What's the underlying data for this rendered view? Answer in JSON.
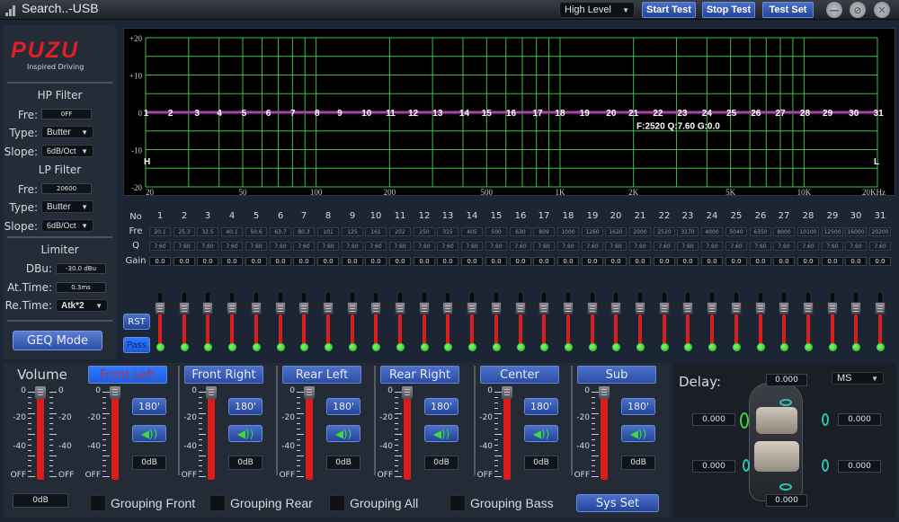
{
  "titlebar": {
    "app_title": "Search..-USB",
    "input_mode": "High Level",
    "buttons": [
      "Start Test",
      "Stop Test",
      "Test Set"
    ],
    "window_controls": [
      "minimize-icon",
      "restore-icon",
      "close-icon"
    ]
  },
  "brand": {
    "logo": "PUZU",
    "tagline": "Inspired Driving"
  },
  "hp_filter": {
    "title": "HP Filter",
    "fre_label": "Fre:",
    "fre": "0FF",
    "type_label": "Type:",
    "type": "Butter",
    "slope_label": "Slope:",
    "slope": "6dB/Oct"
  },
  "lp_filter": {
    "title": "LP Filter",
    "fre_label": "Fre:",
    "fre": "20600",
    "type_label": "Type:",
    "type": "Butter",
    "slope_label": "Slope:",
    "slope": "6dB/Oct"
  },
  "limiter": {
    "title": "Limiter",
    "dbu_label": "DBu:",
    "dbu": "-30.0 dBu",
    "at_label": "At.Time:",
    "at": "0.3ms",
    "re_label": "Re.Time:",
    "re": "Atk*2"
  },
  "geq_mode_label": "GEQ Mode",
  "graph": {
    "y_ticks": [
      "+20",
      "+10",
      "0",
      "-10",
      "-20"
    ],
    "x_ticks": [
      "20",
      "50",
      "100",
      "200",
      "500",
      "1K",
      "2K",
      "5K",
      "10K",
      "20KHz"
    ],
    "left_marker": "H",
    "right_marker": "L",
    "readout": "F:2520 Q:7.60 G:0.0",
    "curve_color": "#b03fb0",
    "grid_color": "#3fbf3f"
  },
  "eq": {
    "row_labels": {
      "no": "No",
      "fre": "Fre",
      "q": "Q",
      "gain": "Gain"
    },
    "bands": [
      {
        "no": "1",
        "fre": "20.1",
        "q": "7.60",
        "gain": "0.0"
      },
      {
        "no": "2",
        "fre": "25.3",
        "q": "7.60",
        "gain": "0.0"
      },
      {
        "no": "3",
        "fre": "32.5",
        "q": "7.60",
        "gain": "0.0"
      },
      {
        "no": "4",
        "fre": "40.1",
        "q": "7.60",
        "gain": "0.0"
      },
      {
        "no": "5",
        "fre": "50.6",
        "q": "7.60",
        "gain": "0.0"
      },
      {
        "no": "6",
        "fre": "63.7",
        "q": "7.60",
        "gain": "0.0"
      },
      {
        "no": "7",
        "fre": "80.3",
        "q": "7.60",
        "gain": "0.0"
      },
      {
        "no": "8",
        "fre": "101",
        "q": "7.60",
        "gain": "0.0"
      },
      {
        "no": "9",
        "fre": "125",
        "q": "7.60",
        "gain": "0.0"
      },
      {
        "no": "10",
        "fre": "161",
        "q": "7.60",
        "gain": "0.0"
      },
      {
        "no": "11",
        "fre": "202",
        "q": "7.60",
        "gain": "0.0"
      },
      {
        "no": "12",
        "fre": "250",
        "q": "7.60",
        "gain": "0.0"
      },
      {
        "no": "13",
        "fre": "315",
        "q": "7.60",
        "gain": "0.0"
      },
      {
        "no": "14",
        "fre": "405",
        "q": "7.60",
        "gain": "0.0"
      },
      {
        "no": "15",
        "fre": "500",
        "q": "7.60",
        "gain": "0.0"
      },
      {
        "no": "16",
        "fre": "630",
        "q": "7.60",
        "gain": "0.0"
      },
      {
        "no": "17",
        "fre": "809",
        "q": "7.60",
        "gain": "0.0"
      },
      {
        "no": "18",
        "fre": "1000",
        "q": "7.60",
        "gain": "0.0"
      },
      {
        "no": "19",
        "fre": "1260",
        "q": "7.60",
        "gain": "0.0"
      },
      {
        "no": "20",
        "fre": "1620",
        "q": "7.60",
        "gain": "0.0"
      },
      {
        "no": "21",
        "fre": "2000",
        "q": "7.60",
        "gain": "0.0"
      },
      {
        "no": "22",
        "fre": "2520",
        "q": "7.60",
        "gain": "0.0"
      },
      {
        "no": "23",
        "fre": "3170",
        "q": "7.60",
        "gain": "0.0"
      },
      {
        "no": "24",
        "fre": "4000",
        "q": "7.60",
        "gain": "0.0"
      },
      {
        "no": "25",
        "fre": "5040",
        "q": "7.60",
        "gain": "0.0"
      },
      {
        "no": "26",
        "fre": "6350",
        "q": "7.60",
        "gain": "0.0"
      },
      {
        "no": "27",
        "fre": "8000",
        "q": "7.60",
        "gain": "0.0"
      },
      {
        "no": "28",
        "fre": "10100",
        "q": "7.60",
        "gain": "0.0"
      },
      {
        "no": "29",
        "fre": "12500",
        "q": "7.60",
        "gain": "0.0"
      },
      {
        "no": "30",
        "fre": "16000",
        "q": "7.60",
        "gain": "0.0"
      },
      {
        "no": "31",
        "fre": "20200",
        "q": "7.60",
        "gain": "0.0"
      }
    ],
    "rst_label": "RST",
    "pass_label": "Pass",
    "gain_range_db": [
      -20,
      20
    ]
  },
  "volume": {
    "title": "Volume",
    "value": "0dB",
    "level_db": 0,
    "scale": [
      "0",
      "-20",
      "-40",
      "OFF"
    ]
  },
  "channels": [
    {
      "name": "Front Left",
      "active": true,
      "phase": "180'",
      "value": "0dB",
      "level_db": 0
    },
    {
      "name": "Front Right",
      "active": false,
      "phase": "180'",
      "value": "0dB",
      "level_db": 0
    },
    {
      "name": "Rear Left",
      "active": false,
      "phase": "180'",
      "value": "0dB",
      "level_db": 0
    },
    {
      "name": "Rear Right",
      "active": false,
      "phase": "180'",
      "value": "0dB",
      "level_db": 0
    },
    {
      "name": "Center",
      "active": false,
      "phase": "180'",
      "value": "0dB",
      "level_db": 0
    },
    {
      "name": "Sub",
      "active": false,
      "phase": "180'",
      "value": "0dB",
      "level_db": 0
    }
  ],
  "channel_scale": [
    "0",
    "-20",
    "-40",
    "OFF"
  ],
  "grouping": [
    "Grouping Front",
    "Grouping Rear",
    "Grouping All",
    "Grouping Bass"
  ],
  "sys_set_label": "Sys Set",
  "delay": {
    "title": "Delay:",
    "unit": "MS",
    "center_front": "0.000",
    "front_left": "0.000",
    "front_right": "0.000",
    "rear_left": "0.000",
    "rear_right": "0.000",
    "sub": "0.000"
  }
}
